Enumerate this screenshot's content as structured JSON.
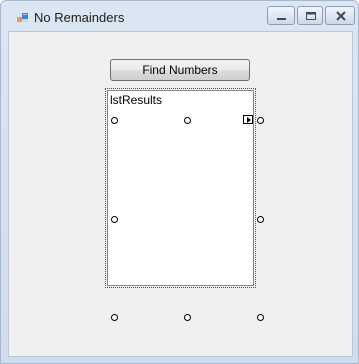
{
  "window": {
    "title": "No Remainders",
    "icon": "form-icon"
  },
  "caption_buttons": {
    "minimize_icon": "minimize-icon",
    "maximize_icon": "maximize-icon",
    "close_icon": "close-icon"
  },
  "form": {
    "find_button_label": "Find Numbers",
    "listbox_name": "lstResults",
    "smart_tag_icon": "smart-tag-arrow-icon"
  }
}
